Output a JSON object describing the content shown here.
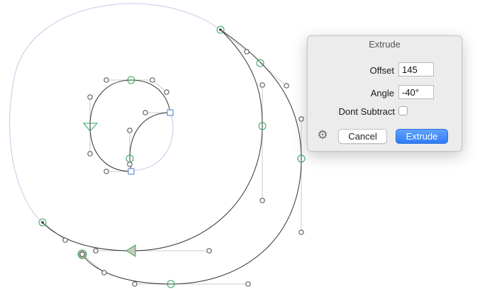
{
  "dialog": {
    "title": "Extrude",
    "offset_label": "Offset",
    "offset_value": "145",
    "angle_label": "Angle",
    "angle_value": "-40°",
    "dont_subtract_label": "Dont Subtract",
    "dont_subtract_checked": false,
    "cancel_label": "Cancel",
    "extrude_label": "Extrude",
    "settings_icon": "gear-icon"
  },
  "colors": {
    "outline_stroke": "#333333",
    "preview_stroke": "#c8c8e6",
    "handle_line": "#bdbdbd",
    "on_curve_point": "#2ea35a",
    "corner_point": "#4a7bd0",
    "selected_point_fill": "#b3b3a8",
    "primary_button": "#2f7cf6"
  }
}
